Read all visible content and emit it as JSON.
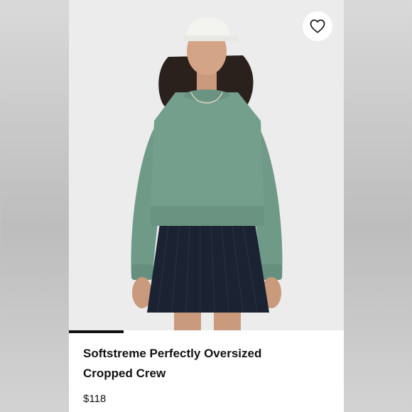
{
  "product": {
    "title": "Softstreme Perfectly Oversized\nCropped Crew",
    "price": "$118",
    "image_alt": "Model wearing green oversized cropped crew sweatshirt with navy pleated skirt and white cap"
  },
  "favorite": {
    "icon": "heart-icon",
    "selected": false
  },
  "carousel": {
    "current_slide": 1,
    "progress_fraction": 0.2
  },
  "colors": {
    "sweatshirt": "#6f9a88",
    "skirt": "#1b2232",
    "cap": "#f3f3f0",
    "photo_bg": "#ececec",
    "indicator": "#111111"
  }
}
